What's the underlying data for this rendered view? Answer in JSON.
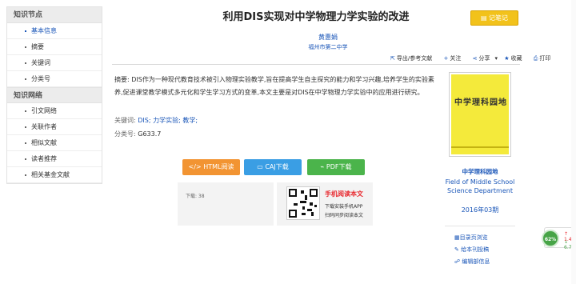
{
  "sidebar": {
    "group1_label": "知识节点",
    "group1_items": [
      {
        "label": "基本信息"
      },
      {
        "label": "摘要"
      },
      {
        "label": "关键词"
      },
      {
        "label": "分类号"
      }
    ],
    "group2_label": "知识网络",
    "group2_items": [
      {
        "label": "引文网络"
      },
      {
        "label": "关联作者"
      },
      {
        "label": "相似文献"
      },
      {
        "label": "读者推荐"
      },
      {
        "label": "相关基金文献"
      }
    ]
  },
  "article": {
    "title": "利用DIS实现对中学物理力学实验的改进",
    "note_button": "记笔记",
    "author": "黄惠娟",
    "affiliation": "福州市第二中学",
    "tools": {
      "export": "导出/参考文献",
      "follow": "关注",
      "share": "分享",
      "favorite": "收藏",
      "print": "打印"
    },
    "abstract_label": "摘要:",
    "abstract": "DIS作为一种现代教育技术被引入物理实验教学,旨在提高学生自主探究的能力和学习兴趣,培养学生的实验素养,促进课堂教学模式多元化和学生学习方式的变革,本文主要是对DIS在中学物理力学实验中的应用进行研究。",
    "keywords_label": "关键词:",
    "keywords": "DIS; 力学实验; 教学;",
    "class_label": "分类号:",
    "class_value": "G633.7"
  },
  "downloads": {
    "html_label": "HTML阅读",
    "caj_label": "CAJ下载",
    "pdf_label": "PDF下载",
    "download_count": "下载: 38",
    "mobile_title": "手机阅读本文",
    "mobile_line1": "下载安装手机APP",
    "mobile_line2": "扫码同步阅读本文"
  },
  "journal": {
    "cover_name": "中学理科园地",
    "name": "中学理科园地",
    "english_name": "Field of Middle School Science Department",
    "issue": "2016年03期",
    "links": [
      "目录页浏览",
      "给本刊投稿",
      "编辑部信息"
    ]
  },
  "widget": {
    "percent": "62%",
    "up_value": "1.4",
    "down_value": "6.7"
  },
  "colors": {
    "link": "#1a56b8",
    "html_button": "#f29432",
    "caj_button": "#3a9ee4",
    "pdf_button": "#4bb44b",
    "note_button": "#f2c21b"
  }
}
